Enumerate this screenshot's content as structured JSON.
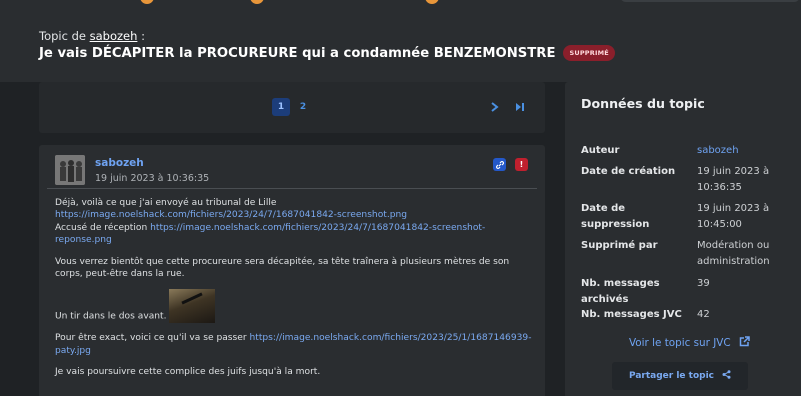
{
  "topic": {
    "prefix": "Topic de",
    "author": "sabozeh",
    "colon": ":",
    "title": "Je vais DÉCAPITER la PROCUREURE qui a condamnée BENZEMONSTRE",
    "badge": "SUPPRIMÉ"
  },
  "pagination": {
    "pages": [
      "1",
      "2"
    ],
    "current": "1",
    "next_icon": "chevron-right-icon",
    "last_icon": "skip-last-icon"
  },
  "post": {
    "author": "sabozeh",
    "date": "19 juin 2023 à 10:36:35",
    "link_icon": "link-icon",
    "report_icon": "exclamation-icon",
    "p1_text": "Déjà, voilà ce que j'ai envoyé au tribunal de Lille ",
    "p1_link": "https://image.noelshack.com/fichiers/2023/24/7/1687041842-screenshot.png",
    "p1_text2": "Accusé de réception ",
    "p1_link2": "https://image.noelshack.com/fichiers/2023/24/7/1687041842-screenshot-reponse.png",
    "p2": "Vous verrez bientôt que cette procureure sera décapitée, sa tête traînera à plusieurs mètres de son corps, peut-être dans la rue.",
    "p3": "Un tir dans le dos avant.",
    "p4_text": "Pour être exact, voici ce qu'il va se passer ",
    "p4_link": "https://image.noelshack.com/fichiers/2023/25/1/1687146939-paty.jpg",
    "p5": "Je vais poursuivre cette complice des juifs jusqu'à la mort."
  },
  "sidebar": {
    "title": "Données du topic",
    "rows": [
      {
        "label": "Auteur",
        "value": "sabozeh"
      },
      {
        "label": "Date de création",
        "value": "19 juin 2023 à 10:36:35"
      },
      {
        "label": "Date de suppression",
        "value": "19 juin 2023 à 10:45:00"
      },
      {
        "label": "Supprimé par",
        "value": "Modération ou administration"
      },
      {
        "label": "Nb. messages archivés",
        "value": "39"
      },
      {
        "label": "Nb. messages JVC",
        "value": "42"
      }
    ],
    "jvc_link": "Voir le topic sur JVC",
    "share_label": "Partager le topic"
  }
}
